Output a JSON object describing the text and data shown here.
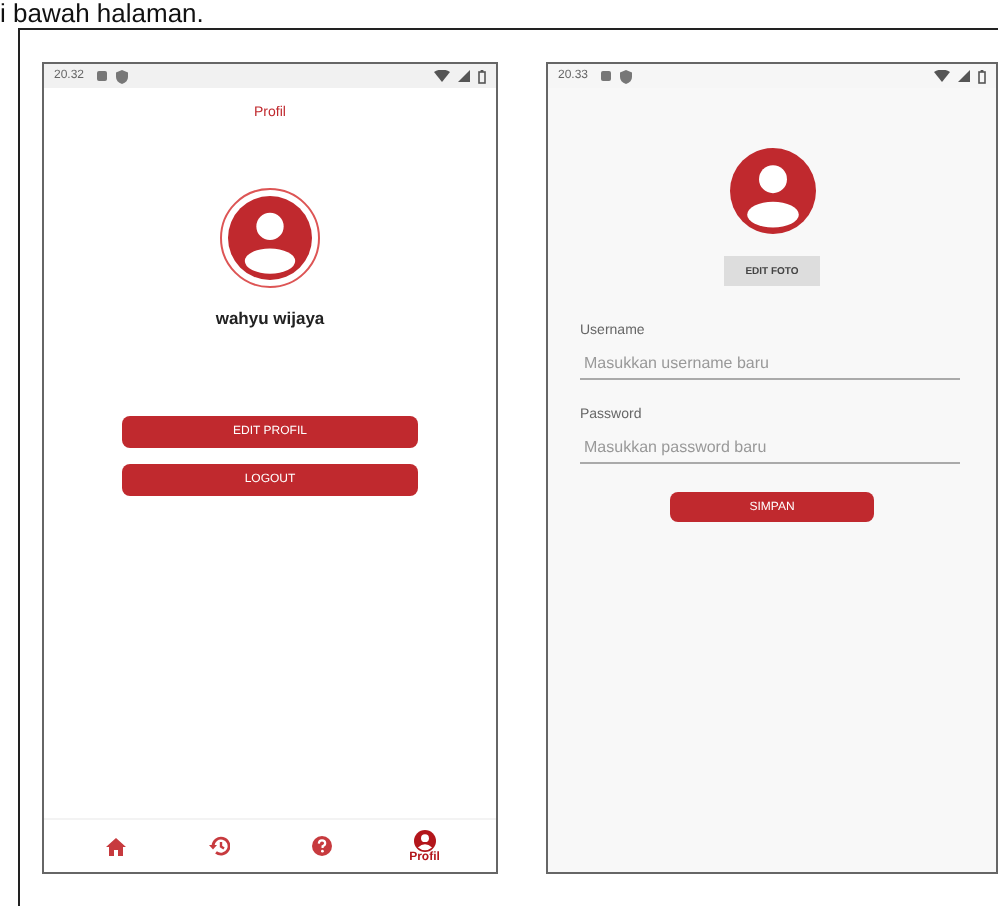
{
  "doc_text": "i bawah halaman.",
  "screens": [
    {
      "kind": "profile",
      "status_time": "20.32",
      "title": "Profil",
      "user_name": "wahyu wijaya",
      "buttons": [
        "EDIT PROFIL",
        "LOGOUT"
      ],
      "nav": [
        {
          "kind": "home",
          "selected": false
        },
        {
          "kind": "history",
          "selected": false
        },
        {
          "kind": "help",
          "selected": false
        },
        {
          "kind": "profile",
          "label": "Profil",
          "selected": true
        }
      ]
    },
    {
      "kind": "edit",
      "status_time": "20.33",
      "photo_button": "EDIT FOTO",
      "fields": [
        {
          "label": "Username",
          "placeholder": "Masukkan username baru"
        },
        {
          "label": "Password",
          "placeholder": "Masukkan password baru"
        }
      ],
      "save_button": "SIMPAN"
    }
  ]
}
